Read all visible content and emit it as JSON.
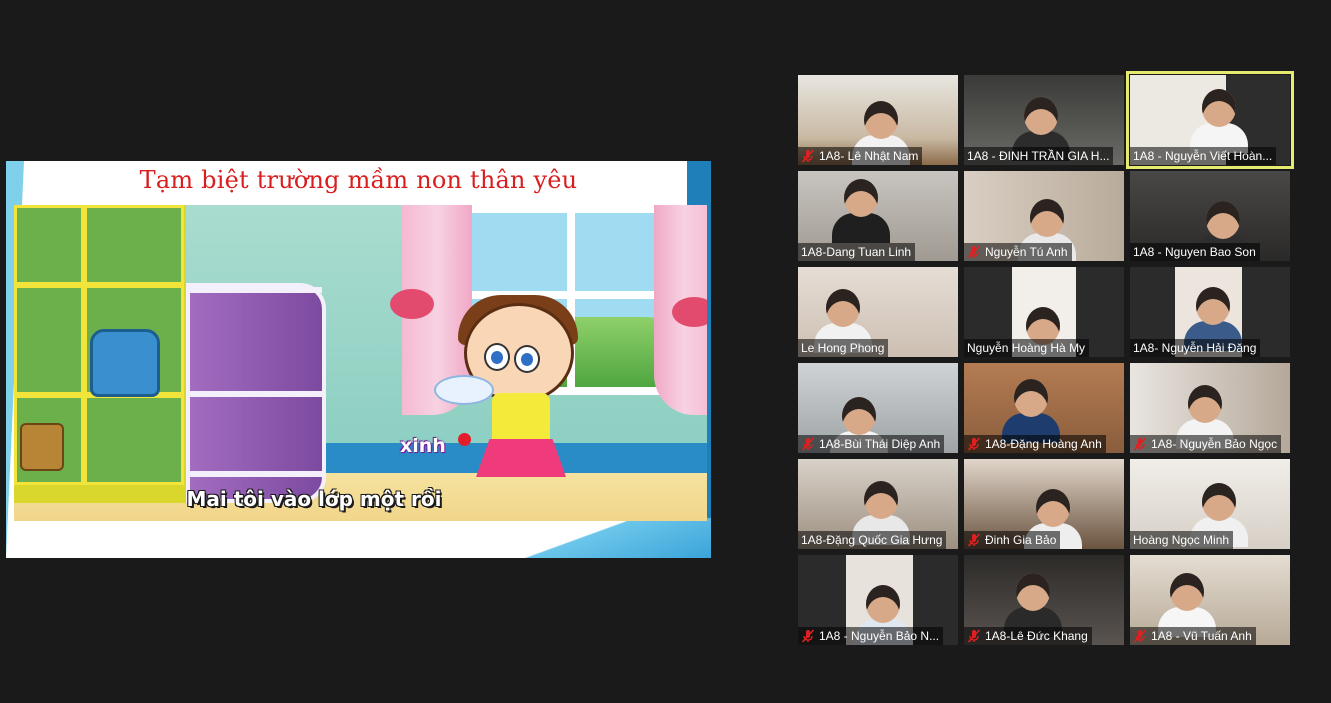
{
  "share": {
    "slide_title": "Tạm biệt trường mầm non thân yêu",
    "karaoke_word": "xinh",
    "karaoke_line": "Mai tôi vào lớp một rồi"
  },
  "colors": {
    "background": "#1a1a1a",
    "active_speaker_border": "#e6ea6e",
    "muted_icon": "#e02020",
    "title_red": "#d81e1e"
  },
  "participants": [
    {
      "name": "1A8- Lê Nhật Nam",
      "muted": true,
      "active": false
    },
    {
      "name": "1A8 - ĐINH TRẦN GIA H...",
      "muted": false,
      "active": false
    },
    {
      "name": "1A8 - Nguyễn Viết Hoàn...",
      "muted": false,
      "active": true
    },
    {
      "name": "1A8-Dang Tuan Linh",
      "muted": false,
      "active": false
    },
    {
      "name": "Nguyễn Tú Anh",
      "muted": true,
      "active": false
    },
    {
      "name": "1A8 - Nguyen Bao Son",
      "muted": false,
      "active": false
    },
    {
      "name": "Le Hong Phong",
      "muted": false,
      "active": false
    },
    {
      "name": "Nguyễn Hoàng Hà My",
      "muted": false,
      "active": false
    },
    {
      "name": "1A8- Nguyễn Hải Đăng",
      "muted": false,
      "active": false
    },
    {
      "name": "1A8-Bùi Thái Diệp Anh",
      "muted": true,
      "active": false
    },
    {
      "name": "1A8-Đặng Hoàng Anh",
      "muted": true,
      "active": false
    },
    {
      "name": "1A8- Nguyễn Bảo Ngọc",
      "muted": true,
      "active": false
    },
    {
      "name": "1A8-Đặng Quốc Gia Hưng",
      "muted": false,
      "active": false
    },
    {
      "name": "Đinh Gia Bảo",
      "muted": true,
      "active": false
    },
    {
      "name": "Hoàng Ngọc Minh",
      "muted": false,
      "active": false
    },
    {
      "name": "1A8 - Nguyễn Bảo N...",
      "muted": true,
      "active": false
    },
    {
      "name": "1A8-Lê Đức Khang",
      "muted": true,
      "active": false
    },
    {
      "name": "1A8 - Vũ Tuấn Anh",
      "muted": true,
      "active": false
    }
  ]
}
